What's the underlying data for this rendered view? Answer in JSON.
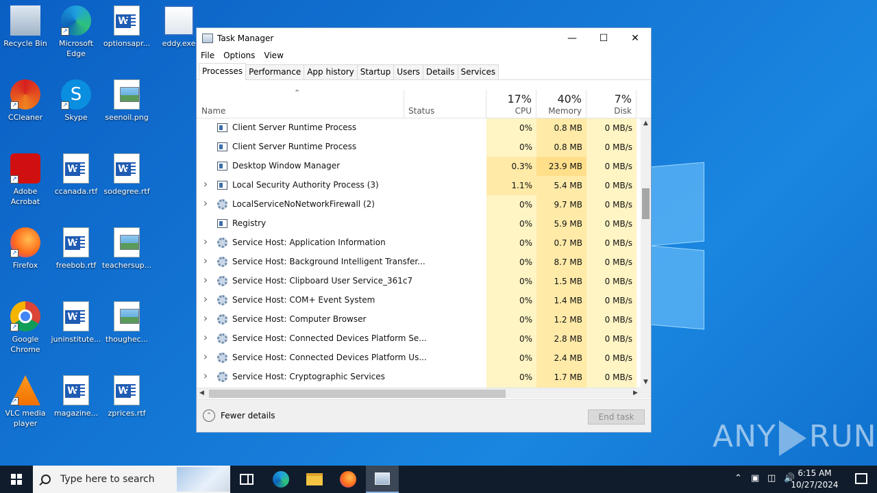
{
  "desktop": {
    "icons": [
      {
        "label": "Recycle Bin",
        "icon": "recycle-bin-icon"
      },
      {
        "label": "Microsoft Edge",
        "icon": "edge-icon"
      },
      {
        "label": "optionsapr...",
        "icon": "word-doc-icon"
      },
      {
        "label": "eddy.exe",
        "icon": "exe-icon"
      },
      {
        "label": "CCleaner",
        "icon": "ccleaner-icon"
      },
      {
        "label": "Skype",
        "icon": "skype-icon"
      },
      {
        "label": "seenoil.png",
        "icon": "image-file-icon"
      },
      {
        "label": "Adobe Acrobat",
        "icon": "acrobat-icon"
      },
      {
        "label": "ccanada.rtf",
        "icon": "word-doc-icon"
      },
      {
        "label": "sodegree.rtf",
        "icon": "word-doc-icon"
      },
      {
        "label": "Firefox",
        "icon": "firefox-icon"
      },
      {
        "label": "freebob.rtf",
        "icon": "word-doc-icon"
      },
      {
        "label": "teachersup...",
        "icon": "image-file-icon"
      },
      {
        "label": "Google Chrome",
        "icon": "chrome-icon"
      },
      {
        "label": "juninstitute...",
        "icon": "word-doc-icon"
      },
      {
        "label": "thoughec...",
        "icon": "image-file-icon"
      },
      {
        "label": "VLC media player",
        "icon": "vlc-icon"
      },
      {
        "label": "magazine...",
        "icon": "word-doc-icon"
      },
      {
        "label": "zprices.rtf",
        "icon": "word-doc-icon"
      }
    ]
  },
  "window": {
    "title": "Task Manager",
    "menu": [
      "File",
      "Options",
      "View"
    ],
    "tabs": [
      "Processes",
      "Performance",
      "App history",
      "Startup",
      "Users",
      "Details",
      "Services"
    ],
    "active_tab": "Processes"
  },
  "columns": {
    "name": "Name",
    "status": "Status",
    "cpu": {
      "pct": "17%",
      "label": "CPU"
    },
    "memory": {
      "pct": "40%",
      "label": "Memory"
    },
    "disk": {
      "pct": "7%",
      "label": "Disk"
    }
  },
  "processes": [
    {
      "name": "Client Server Runtime Process",
      "expandable": false,
      "icon": "window-app-icon",
      "cpu": "0%",
      "memory": "0.8 MB",
      "disk": "0 MB/s"
    },
    {
      "name": "Client Server Runtime Process",
      "expandable": false,
      "icon": "window-app-icon",
      "cpu": "0%",
      "memory": "0.8 MB",
      "disk": "0 MB/s"
    },
    {
      "name": "Desktop Window Manager",
      "expandable": false,
      "icon": "window-app-icon",
      "cpu": "0.3%",
      "memory": "23.9 MB",
      "disk": "0 MB/s"
    },
    {
      "name": "Local Security Authority Process (3)",
      "expandable": true,
      "icon": "window-app-icon",
      "cpu": "1.1%",
      "memory": "5.4 MB",
      "disk": "0 MB/s"
    },
    {
      "name": "LocalServiceNoNetworkFirewall (2)",
      "expandable": true,
      "icon": "gear-icon",
      "cpu": "0%",
      "memory": "9.7 MB",
      "disk": "0 MB/s"
    },
    {
      "name": "Registry",
      "expandable": false,
      "icon": "window-app-icon",
      "cpu": "0%",
      "memory": "5.9 MB",
      "disk": "0 MB/s"
    },
    {
      "name": "Service Host: Application Information",
      "expandable": true,
      "icon": "gear-icon",
      "cpu": "0%",
      "memory": "0.7 MB",
      "disk": "0 MB/s"
    },
    {
      "name": "Service Host: Background Intelligent Transfer...",
      "expandable": true,
      "icon": "gear-icon",
      "cpu": "0%",
      "memory": "8.7 MB",
      "disk": "0 MB/s"
    },
    {
      "name": "Service Host: Clipboard User Service_361c7",
      "expandable": true,
      "icon": "gear-icon",
      "cpu": "0%",
      "memory": "1.5 MB",
      "disk": "0 MB/s"
    },
    {
      "name": "Service Host: COM+ Event System",
      "expandable": true,
      "icon": "gear-icon",
      "cpu": "0%",
      "memory": "1.4 MB",
      "disk": "0 MB/s"
    },
    {
      "name": "Service Host: Computer Browser",
      "expandable": true,
      "icon": "gear-icon",
      "cpu": "0%",
      "memory": "1.2 MB",
      "disk": "0 MB/s"
    },
    {
      "name": "Service Host: Connected Devices Platform Se...",
      "expandable": true,
      "icon": "gear-icon",
      "cpu": "0%",
      "memory": "2.8 MB",
      "disk": "0 MB/s"
    },
    {
      "name": "Service Host: Connected Devices Platform Us...",
      "expandable": true,
      "icon": "gear-icon",
      "cpu": "0%",
      "memory": "2.4 MB",
      "disk": "0 MB/s"
    },
    {
      "name": "Service Host: Cryptographic Services",
      "expandable": true,
      "icon": "gear-icon",
      "cpu": "0%",
      "memory": "1.7 MB",
      "disk": "0 MB/s"
    }
  ],
  "footer": {
    "fewer_details": "Fewer details",
    "end_task": "End task"
  },
  "watermark": {
    "left": "ANY",
    "right": "RUN"
  },
  "taskbar": {
    "search_placeholder": "Type here to search",
    "time": "6:15 AM",
    "date": "10/27/2024"
  },
  "colors": {
    "cpu_bg_low": "#fff4c4",
    "cpu_bg_mid": "#ffeaa8",
    "mem_bg": "#ffeaa8",
    "disk_bg": "#fff4c4",
    "desktop_blue": "#1478d6"
  }
}
